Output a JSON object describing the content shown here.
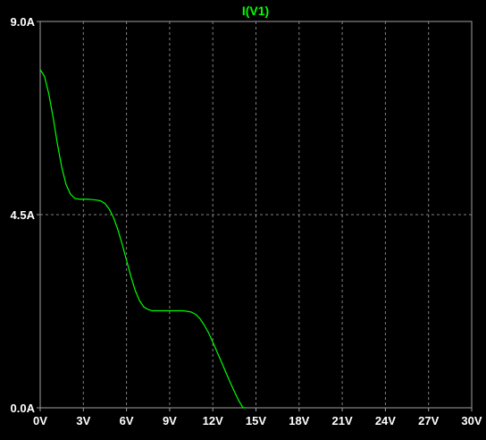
{
  "chart_data": {
    "type": "line",
    "title": "I(V1)",
    "xlabel": "",
    "ylabel": "",
    "xlim": [
      0,
      30
    ],
    "ylim": [
      0,
      9
    ],
    "grid": true,
    "x_ticks": [
      {
        "value": 0,
        "label": "0V"
      },
      {
        "value": 3,
        "label": "3V"
      },
      {
        "value": 6,
        "label": "6V"
      },
      {
        "value": 9,
        "label": "9V"
      },
      {
        "value": 12,
        "label": "12V"
      },
      {
        "value": 15,
        "label": "15V"
      },
      {
        "value": 18,
        "label": "18V"
      },
      {
        "value": 21,
        "label": "21V"
      },
      {
        "value": 24,
        "label": "24V"
      },
      {
        "value": 27,
        "label": "27V"
      },
      {
        "value": 30,
        "label": "30V"
      }
    ],
    "y_ticks": [
      {
        "value": 0,
        "label": "0.0A"
      },
      {
        "value": 4.5,
        "label": "4.5A"
      },
      {
        "value": 9,
        "label": "9.0A"
      }
    ],
    "series": [
      {
        "name": "I(V1)",
        "x": [
          0,
          0.3,
          0.6,
          0.9,
          1.2,
          1.5,
          1.8,
          2.1,
          2.4,
          2.7,
          3.0,
          3.3,
          3.6,
          3.9,
          4.2,
          4.5,
          4.8,
          5.1,
          5.4,
          5.7,
          6.0,
          6.3,
          6.6,
          6.9,
          7.2,
          7.5,
          7.8,
          8.1,
          8.4,
          8.7,
          9.0,
          9.3,
          9.6,
          9.9,
          10.2,
          10.5,
          10.8,
          11.1,
          11.4,
          11.7,
          12.0,
          12.3,
          12.6,
          12.9,
          13.2,
          13.5,
          13.8,
          14.1,
          14.3
        ],
        "values": [
          7.88,
          7.72,
          7.31,
          6.76,
          6.14,
          5.6,
          5.2,
          4.98,
          4.88,
          4.86,
          4.86,
          4.86,
          4.85,
          4.84,
          4.82,
          4.76,
          4.63,
          4.43,
          4.15,
          3.81,
          3.44,
          3.07,
          2.74,
          2.5,
          2.35,
          2.29,
          2.26,
          2.26,
          2.26,
          2.26,
          2.26,
          2.26,
          2.26,
          2.26,
          2.25,
          2.23,
          2.18,
          2.08,
          1.93,
          1.75,
          1.53,
          1.3,
          1.07,
          0.83,
          0.6,
          0.38,
          0.17,
          0.0,
          0.0
        ],
        "color": "#00ff00"
      }
    ],
    "colors": {
      "background": "#000000",
      "axis": "#a0a0a0",
      "grid": "#808080",
      "tick_text": "#ffffff",
      "title": "#00ff00"
    }
  }
}
